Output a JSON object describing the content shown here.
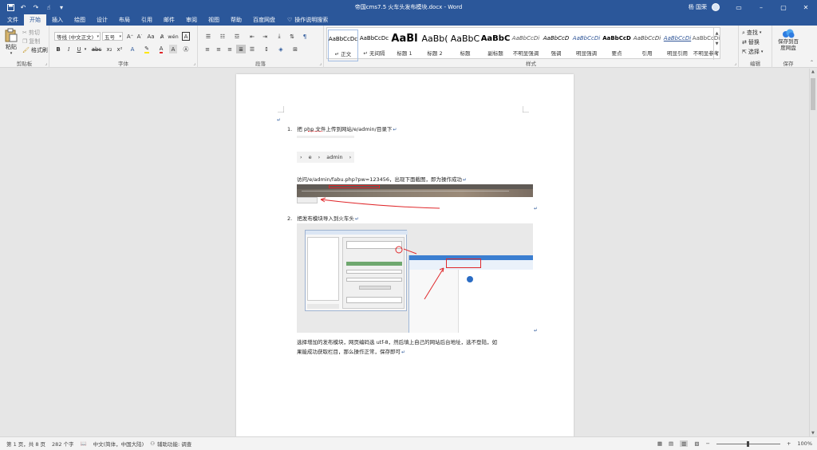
{
  "window": {
    "title": "帝国cms7.5 火车头发布模块.docx - Word",
    "user": "杨 国荣",
    "controls": [
      "–",
      "▢",
      "✕"
    ]
  },
  "ribbon_tabs": [
    "文件",
    "开始",
    "插入",
    "绘图",
    "设计",
    "布局",
    "引用",
    "邮件",
    "审阅",
    "视图",
    "帮助",
    "百度网盘"
  ],
  "active_tab": "开始",
  "tell_me": "操作说明搜索",
  "clipboard": {
    "paste": "粘贴",
    "cut": "剪切",
    "copy": "复制",
    "format_painter": "格式刷",
    "label": "剪贴板"
  },
  "font": {
    "family": "等线 (中文正文)",
    "size": "五号",
    "label": "字体"
  },
  "paragraph": {
    "label": "段落"
  },
  "styles": {
    "label": "样式",
    "items": [
      {
        "sample": "AaBbCcDc",
        "name": "↵ 正文"
      },
      {
        "sample": "AaBbCcDc",
        "name": "↵ 无间隔"
      },
      {
        "sample": "AaBl",
        "name": "标题 1"
      },
      {
        "sample": "AaBb(",
        "name": "标题 2"
      },
      {
        "sample": "AaBbC",
        "name": "标题"
      },
      {
        "sample": "AaBbC",
        "name": "副标题"
      },
      {
        "sample": "AaBbCcDi",
        "name": "不明显强调"
      },
      {
        "sample": "AaBbCcD",
        "name": "强调"
      },
      {
        "sample": "AaBbCcDi",
        "name": "明显强调"
      },
      {
        "sample": "AaBbCcD",
        "name": "要点"
      },
      {
        "sample": "AaBbCcDi",
        "name": "引用"
      },
      {
        "sample": "AaBbCcDi",
        "name": "明显引用"
      },
      {
        "sample": "AaBbCcDi",
        "name": "不明显参考"
      }
    ]
  },
  "editing": {
    "find": "查找",
    "replace": "替换",
    "select": "选择",
    "label": "编辑"
  },
  "save_group": {
    "button": "保存到百度网盘",
    "label": "保存"
  },
  "document": {
    "line1": "把 php 文件上传到网站/e/admin/目录下",
    "breadcrumb": [
      "e",
      "admin"
    ],
    "line2": "访问/e/admin/fabu.php?pw=123456，出现下面截图，即为操作成功",
    "line3": "把发布模块导入到火车头",
    "line4a": "选择增加的发布模块，网页编码选 utf-8，然后填上自己的网站后台地址，选不登陆，如",
    "line4b": "果能成功获取栏目，那么操作正常，保存即可"
  },
  "status": {
    "page": "第 1 页，共 8 页",
    "words": "282 个字",
    "language": "中文(简体，中国大陆)",
    "accessibility": "辅助功能: 调查",
    "zoom": "100%"
  },
  "colors": {
    "accent": "#2b579a",
    "ribbon_bg": "#f3f3f3",
    "annotation_red": "#e0282b"
  }
}
